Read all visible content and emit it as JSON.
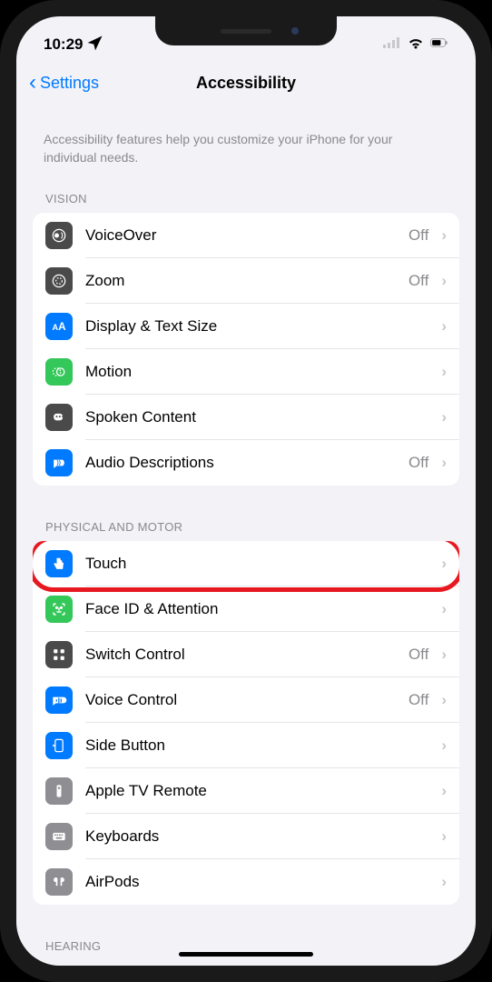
{
  "status": {
    "time": "10:29"
  },
  "nav": {
    "back": "Settings",
    "title": "Accessibility"
  },
  "intro": "Accessibility features help you customize your iPhone for your individual needs.",
  "sections": {
    "vision": {
      "header": "VISION",
      "items": [
        {
          "label": "VoiceOver",
          "value": "Off"
        },
        {
          "label": "Zoom",
          "value": "Off"
        },
        {
          "label": "Display & Text Size",
          "value": ""
        },
        {
          "label": "Motion",
          "value": ""
        },
        {
          "label": "Spoken Content",
          "value": ""
        },
        {
          "label": "Audio Descriptions",
          "value": "Off"
        }
      ]
    },
    "physical": {
      "header": "PHYSICAL AND MOTOR",
      "items": [
        {
          "label": "Touch",
          "value": ""
        },
        {
          "label": "Face ID & Attention",
          "value": ""
        },
        {
          "label": "Switch Control",
          "value": "Off"
        },
        {
          "label": "Voice Control",
          "value": "Off"
        },
        {
          "label": "Side Button",
          "value": ""
        },
        {
          "label": "Apple TV Remote",
          "value": ""
        },
        {
          "label": "Keyboards",
          "value": ""
        },
        {
          "label": "AirPods",
          "value": ""
        }
      ]
    },
    "hearing": {
      "header": "HEARING"
    }
  }
}
